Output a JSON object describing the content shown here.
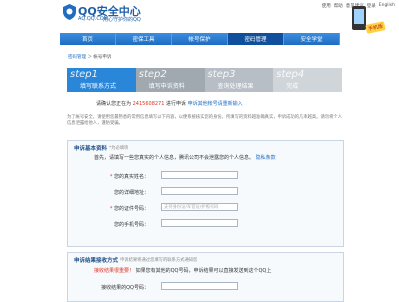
{
  "header": {
    "title": "QQ安全中心",
    "url": "AQ.QQ.COM",
    "slogan": "用心守护你的QQ",
    "toplinks": [
      "使用",
      "帮助",
      "意见建议",
      "登录",
      "English"
    ],
    "phone_badge": "手机版"
  },
  "nav": {
    "items": [
      "首页",
      "密保工具",
      "帐号保护",
      "密码管理",
      "安全学堂"
    ],
    "active_index": 3
  },
  "breadcrumb": {
    "parent": "密码管理",
    "separator": "＞",
    "current": "帐号申诉"
  },
  "steps": [
    {
      "num": "step1",
      "label": "填写联系方式"
    },
    {
      "num": "step2",
      "label": "填写申诉资料"
    },
    {
      "num": "step3",
      "label": "查询处理结果"
    },
    {
      "num": "step4",
      "label": "完成"
    }
  ],
  "notice": {
    "prefix": "请确认您正在为",
    "account": "2415608271",
    "suffix": "进行申诉",
    "link": "申诉其他帐号请重新输入"
  },
  "description": "为了帐号安全，请使用您最熟悉的常用信息填写以下内容，以便系统核实您的身份。所填写的资料越准确真实，申诉成功的几率越高。请勿将个人信息泄露给他人，谨防受骗。",
  "section1": {
    "title": "申诉基本资料",
    "subtitle": "*为必填项",
    "hint_prefix": "首先，请填写一些您真实的个人信息，腾讯公司不会泄露您的个人信息。",
    "hint_link": "隐私条款",
    "fields": [
      {
        "label": "您的真实姓名：",
        "required": true,
        "placeholder": ""
      },
      {
        "label": "您的详细地址：",
        "required": false,
        "placeholder": ""
      },
      {
        "label": "您的证件号码：",
        "required": true,
        "placeholder": "支持身份证/军官证/护照号码"
      },
      {
        "label": "您的手机号码：",
        "required": false,
        "placeholder": ""
      }
    ]
  },
  "section2": {
    "title": "申诉结果接收方式",
    "subtitle": "申诉结果将通过您填写的联系方式通知您",
    "hint_warn": "接收结果很重要！",
    "hint_text": "如果您有其他的QQ号码，申诉结果可以直接发送到这个QQ上",
    "field_label": "接收结果的QQ号码："
  }
}
